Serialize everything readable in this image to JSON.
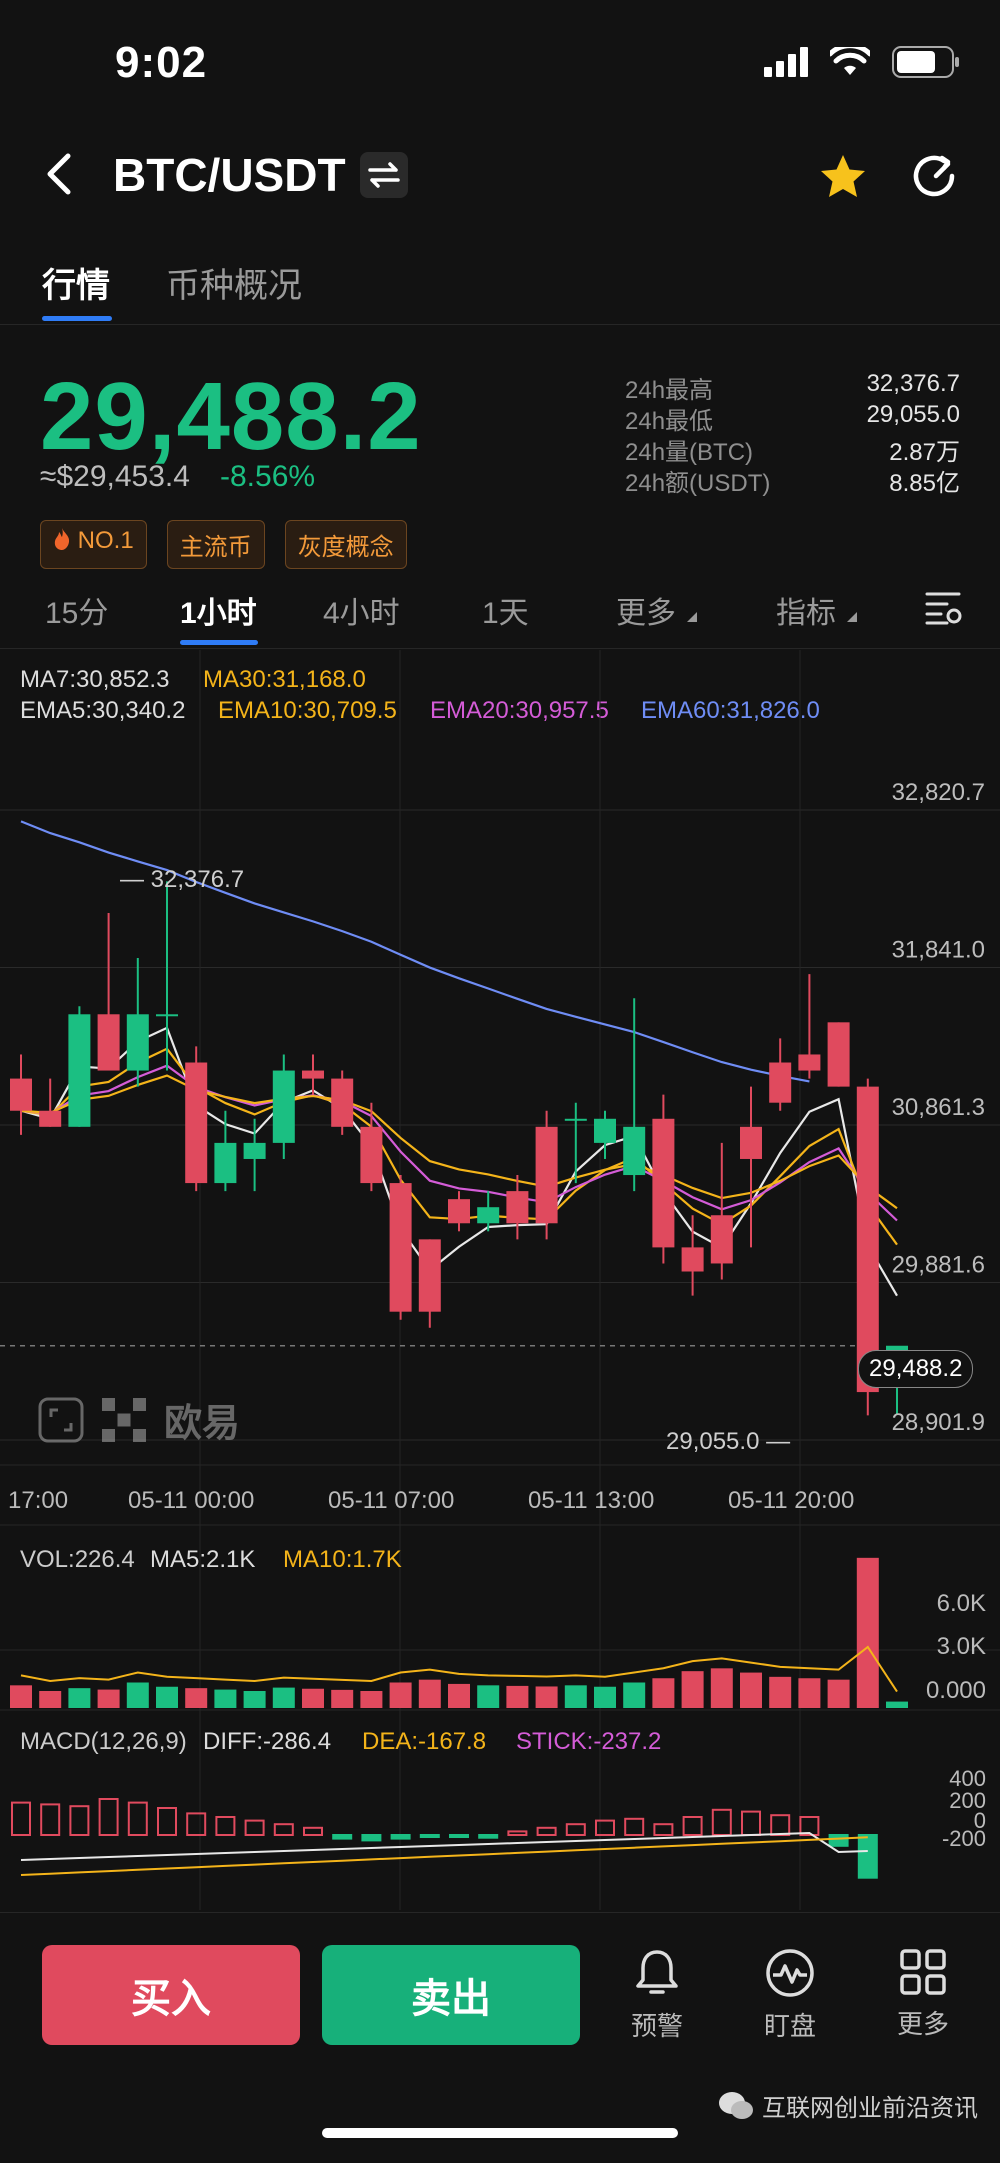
{
  "status": {
    "time": "9:02"
  },
  "header": {
    "pair": "BTC/USDT"
  },
  "tabs": {
    "market": "行情",
    "overview": "币种概况"
  },
  "price": {
    "last": "29,488.2",
    "usd": "≈$29,453.4",
    "change_pct": "-8.56%"
  },
  "stats": [
    {
      "label": "24h最高",
      "value": "32,376.7"
    },
    {
      "label": "24h最低",
      "value": "29,055.0"
    },
    {
      "label": "24h量(BTC)",
      "value": "2.87万"
    },
    {
      "label": "24h额(USDT)",
      "value": "8.85亿"
    }
  ],
  "tags": {
    "no1": "NO.1",
    "main": "主流币",
    "gray": "灰度概念"
  },
  "intervals": {
    "i15m": "15分",
    "i1h": "1小时",
    "i4h": "4小时",
    "i1d": "1天",
    "more": "更多",
    "indicators": "指标"
  },
  "indicators": {
    "ma7": "MA7:30,852.3",
    "ma30": "MA30:31,168.0",
    "ema5": "EMA5:30,340.2",
    "ema10": "EMA10:30,709.5",
    "ema20": "EMA20:30,957.5",
    "ema60": "EMA60:31,826.0"
  },
  "chart_labels": {
    "high_marker": "32,376.7",
    "low_marker": "29,055.0",
    "current_price": "29,488.2",
    "brand": "欧易"
  },
  "volume": {
    "vol": "VOL:226.4",
    "ma5": "MA5:2.1K",
    "ma10": "MA10:1.7K",
    "ticks": [
      "6.0K",
      "3.0K",
      "0.000"
    ]
  },
  "macd": {
    "title": "MACD(12,26,9)",
    "diff": "DIFF:-286.4",
    "dea": "DEA:-167.8",
    "stick": "STICK:-237.2",
    "ticks": [
      "400",
      "200",
      "0",
      "-200"
    ]
  },
  "colors": {
    "up": "#1bbf82",
    "down": "#e04a5e",
    "accent": "#2f7cf6"
  },
  "bottom_nav": {
    "buy": "买入",
    "sell": "卖出",
    "alert": "预警",
    "watch": "盯盘",
    "more": "更多"
  },
  "watermark": "互联网创业前沿资讯",
  "chart_data": {
    "type": "candlestick",
    "title": "",
    "x_ticks": [
      "17:00",
      "05-11 00:00",
      "05-11 07:00",
      "05-11 13:00",
      "05-11 20:00"
    ],
    "y_ticks": [
      32820.7,
      31841.0,
      30861.3,
      29881.6,
      28901.9
    ],
    "ylim": [
      28901.9,
      32820.7
    ],
    "candles": [
      {
        "o": 31150,
        "h": 31300,
        "l": 30800,
        "c": 30950
      },
      {
        "o": 30950,
        "h": 31150,
        "l": 30850,
        "c": 30850
      },
      {
        "o": 30850,
        "h": 31600,
        "l": 30850,
        "c": 31550
      },
      {
        "o": 31550,
        "h": 32180,
        "l": 31200,
        "c": 31200
      },
      {
        "o": 31200,
        "h": 31900,
        "l": 31100,
        "c": 31550
      },
      {
        "o": 31550,
        "h": 32376.7,
        "l": 31200,
        "c": 31550
      },
      {
        "o": 31250,
        "h": 31350,
        "l": 30450,
        "c": 30500
      },
      {
        "o": 30500,
        "h": 30950,
        "l": 30450,
        "c": 30750
      },
      {
        "o": 30650,
        "h": 30900,
        "l": 30450,
        "c": 30750
      },
      {
        "o": 30750,
        "h": 31300,
        "l": 30650,
        "c": 31200
      },
      {
        "o": 31200,
        "h": 31300,
        "l": 31050,
        "c": 31150
      },
      {
        "o": 31150,
        "h": 31200,
        "l": 30800,
        "c": 30850
      },
      {
        "o": 30850,
        "h": 31000,
        "l": 30450,
        "c": 30500
      },
      {
        "o": 30500,
        "h": 30550,
        "l": 29650,
        "c": 29700
      },
      {
        "o": 30150,
        "h": 30150,
        "l": 29600,
        "c": 29700
      },
      {
        "o": 30400,
        "h": 30450,
        "l": 30200,
        "c": 30250
      },
      {
        "o": 30250,
        "h": 30450,
        "l": 30200,
        "c": 30350
      },
      {
        "o": 30450,
        "h": 30550,
        "l": 30150,
        "c": 30250
      },
      {
        "o": 30850,
        "h": 30950,
        "l": 30150,
        "c": 30250
      },
      {
        "o": 30900,
        "h": 31000,
        "l": 30500,
        "c": 30900
      },
      {
        "o": 30750,
        "h": 30950,
        "l": 30650,
        "c": 30900
      },
      {
        "o": 30550,
        "h": 31650,
        "l": 30450,
        "c": 30850
      },
      {
        "o": 30900,
        "h": 31050,
        "l": 30000,
        "c": 30100
      },
      {
        "o": 30100,
        "h": 30300,
        "l": 29800,
        "c": 29950
      },
      {
        "o": 30300,
        "h": 30750,
        "l": 29900,
        "c": 30000
      },
      {
        "o": 30850,
        "h": 31100,
        "l": 30100,
        "c": 30650
      },
      {
        "o": 31250,
        "h": 31400,
        "l": 30950,
        "c": 31000
      },
      {
        "o": 31300,
        "h": 31800,
        "l": 31150,
        "c": 31200
      },
      {
        "o": 31500,
        "h": 31500,
        "l": 31100,
        "c": 31100
      },
      {
        "o": 31100,
        "h": 31150,
        "l": 29055.0,
        "c": 29200
      },
      {
        "o": 29300,
        "h": 29350,
        "l": 29060,
        "c": 29488.2
      }
    ],
    "volume": [
      800,
      600,
      700,
      650,
      900,
      750,
      700,
      650,
      600,
      720,
      680,
      640,
      600,
      900,
      1000,
      850,
      800,
      780,
      760,
      800,
      750,
      900,
      1050,
      1300,
      1400,
      1250,
      1100,
      1050,
      1000,
      5300,
      226.4
    ],
    "macd_stick": [
      180,
      170,
      160,
      200,
      180,
      150,
      120,
      100,
      80,
      60,
      40,
      -20,
      -30,
      -20,
      -10,
      -10,
      -15,
      20,
      40,
      60,
      80,
      90,
      60,
      100,
      140,
      130,
      110,
      100,
      -60,
      -237.2
    ]
  }
}
